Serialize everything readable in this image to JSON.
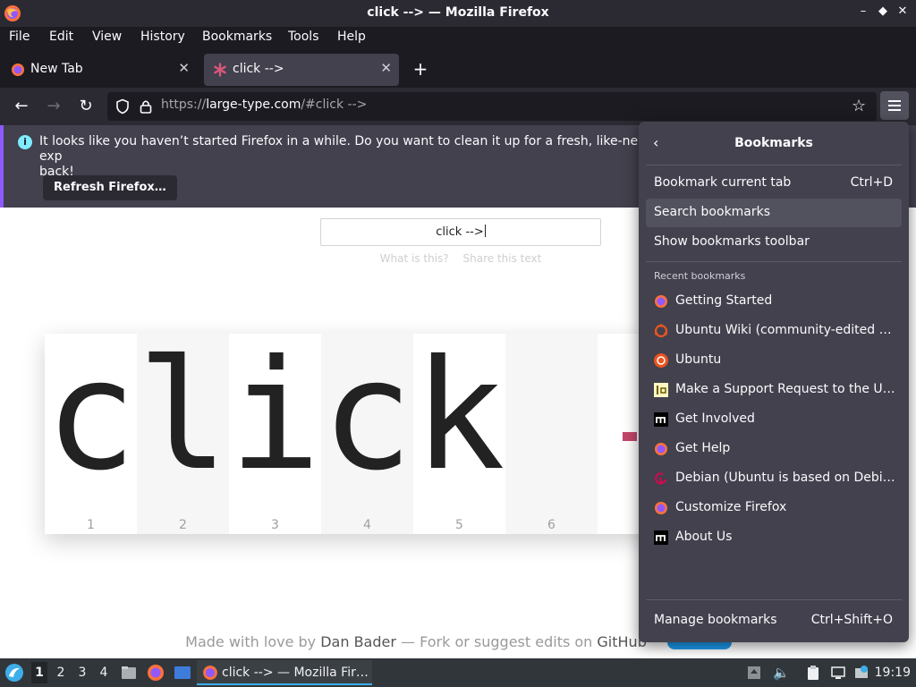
{
  "window": {
    "title": "click --> — Mozilla Firefox"
  },
  "menubar": [
    "File",
    "Edit",
    "View",
    "History",
    "Bookmarks",
    "Tools",
    "Help"
  ],
  "tabs": [
    {
      "label": "New Tab",
      "active": false
    },
    {
      "label": "click -->",
      "active": true
    }
  ],
  "urlbar": {
    "prefix": "https://",
    "host": "large-type.com",
    "rest": "/#click -->"
  },
  "notification": {
    "message": "It looks like you haven’t started Firefox in a while. Do you want to clean it up for a fresh, like-new exp",
    "message_cont": "back!",
    "button": "Refresh Firefox…"
  },
  "page": {
    "input_value": "click -->",
    "link_what": "What is this?",
    "link_share": "Share this text",
    "chars": [
      "c",
      "l",
      "i",
      "c",
      "k",
      " "
    ],
    "numbers": [
      "1",
      "2",
      "3",
      "4",
      "5",
      "6"
    ],
    "footer_prefix": "Made with love by ",
    "footer_author": "Dan Bader",
    "footer_mid": " — Fork or suggest edits on ",
    "footer_link": "GitHub"
  },
  "bookmarks_panel": {
    "title": "Bookmarks",
    "bookmark_current": {
      "label": "Bookmark current tab",
      "shortcut": "Ctrl+D"
    },
    "search": "Search bookmarks",
    "show_toolbar": "Show bookmarks toolbar",
    "recent_header": "Recent bookmarks",
    "recent": [
      {
        "label": "Getting Started",
        "icon": "firefox-icon"
      },
      {
        "label": "Ubuntu Wiki (community-edited website)",
        "icon": "ubuntu-icon"
      },
      {
        "label": "Ubuntu",
        "icon": "ubuntu-icon"
      },
      {
        "label": "Make a Support Request to the Ubuntu Community",
        "icon": "launchpad-icon"
      },
      {
        "label": "Get Involved",
        "icon": "mozilla-icon"
      },
      {
        "label": "Get Help",
        "icon": "firefox-icon"
      },
      {
        "label": "Debian (Ubuntu is based on Debian)",
        "icon": "debian-icon"
      },
      {
        "label": "Customize Firefox",
        "icon": "firefox-icon"
      },
      {
        "label": "About Us",
        "icon": "mozilla-icon"
      }
    ],
    "manage": {
      "label": "Manage bookmarks",
      "shortcut": "Ctrl+Shift+O"
    }
  },
  "taskbar": {
    "workspaces": [
      "1",
      "2",
      "3",
      "4"
    ],
    "task_label": "click --> — Mozilla Fir…",
    "clock": "19:19"
  },
  "colors": {
    "accent": "#9059ff",
    "info": "#80ebff",
    "panel": "#42414d",
    "taskbar_accent": "#3daee9"
  }
}
